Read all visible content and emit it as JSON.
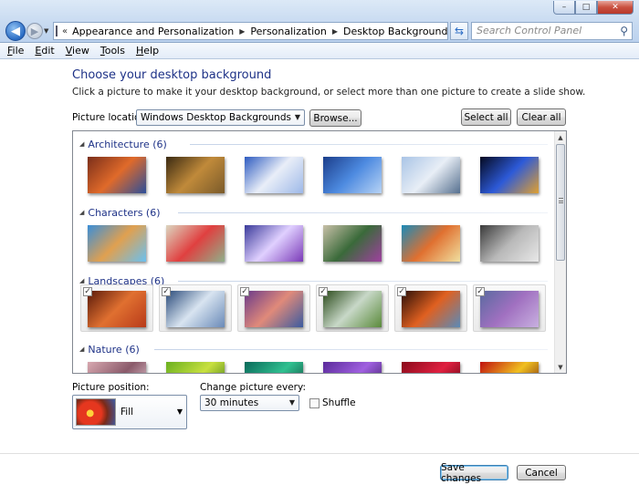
{
  "window": {
    "address": {
      "breadcrumbs": [
        "Appearance and Personalization",
        "Personalization",
        "Desktop Background"
      ],
      "overflow_glyph": "«"
    },
    "search": {
      "placeholder": "Search Control Panel"
    },
    "controls": {
      "minimize": "–",
      "maximize": "□",
      "close": "✕"
    }
  },
  "menu": [
    "File",
    "Edit",
    "View",
    "Tools",
    "Help"
  ],
  "page": {
    "title": "Choose your desktop background",
    "subtitle": "Click a picture to make it your desktop background, or select more than one picture to create a slide show.",
    "picture_location": {
      "label": "Picture location:",
      "value": "Windows Desktop Backgrounds"
    },
    "browse_label": "Browse...",
    "select_all_label": "Select all",
    "clear_all_label": "Clear all"
  },
  "gallery": {
    "groups": [
      {
        "name": "Architecture (6)",
        "selected": false,
        "thumbs": [
          [
            "#7a2e1a",
            "#e06a2a",
            "#2b4e9a"
          ],
          [
            "#3a2a12",
            "#c08a3a",
            "#7a5a2a"
          ],
          [
            "#2e5bc0",
            "#e9eef8",
            "#9db8e8"
          ],
          [
            "#1a3d8a",
            "#4d8ae0",
            "#b7d3f5"
          ],
          [
            "#a9c4e6",
            "#e8eef6",
            "#56708f"
          ],
          [
            "#050a20",
            "#2d5ad8",
            "#e0a030"
          ]
        ]
      },
      {
        "name": "Characters (6)",
        "selected": false,
        "thumbs": [
          [
            "#3a8ed8",
            "#e0a050",
            "#6ac0f0"
          ],
          [
            "#dcd6c0",
            "#e04040",
            "#8fb08a"
          ],
          [
            "#3a3a9a",
            "#e0d0ff",
            "#7a3ab8"
          ],
          [
            "#c8c0a8",
            "#3a6a3a",
            "#a040a0"
          ],
          [
            "#1a8ab8",
            "#e07030",
            "#f0e0a0"
          ],
          [
            "#3a3a3a",
            "#b8b8b8",
            "#e8e8e8"
          ]
        ]
      },
      {
        "name": "Landscapes (6)",
        "selected": true,
        "thumbs": [
          [
            "#5a1a0a",
            "#e07030",
            "#b83a1a"
          ],
          [
            "#2a4a7a",
            "#d8e4f0",
            "#6a8ab8"
          ],
          [
            "#6a3a8a",
            "#e08a7a",
            "#3a5aa0"
          ],
          [
            "#2a4a1a",
            "#c8d8c8",
            "#5a8a3a"
          ],
          [
            "#2a1008",
            "#e06020",
            "#5a8ab8"
          ],
          [
            "#5a6aa0",
            "#a070c0",
            "#c8b0e0"
          ]
        ]
      },
      {
        "name": "Nature (6)",
        "selected": false,
        "thumbs": [
          [
            "#d8a8b0",
            "#8a5a6a",
            "#f0d8e0"
          ],
          [
            "#6ab020",
            "#c8e040",
            "#2a6a10"
          ],
          [
            "#0a6a5a",
            "#30c090",
            "#0a3a30"
          ],
          [
            "#5a2a9a",
            "#a060e0",
            "#2a1050"
          ],
          [
            "#8a0a1a",
            "#e02040",
            "#4a0008"
          ],
          [
            "#c01010",
            "#f0c020",
            "#600808"
          ]
        ]
      }
    ]
  },
  "bottom": {
    "position_label": "Picture position:",
    "position_value": "Fill",
    "change_label": "Change picture every:",
    "change_value": "30 minutes",
    "shuffle_label": "Shuffle"
  },
  "footer": {
    "save_label": "Save changes",
    "cancel_label": "Cancel"
  }
}
